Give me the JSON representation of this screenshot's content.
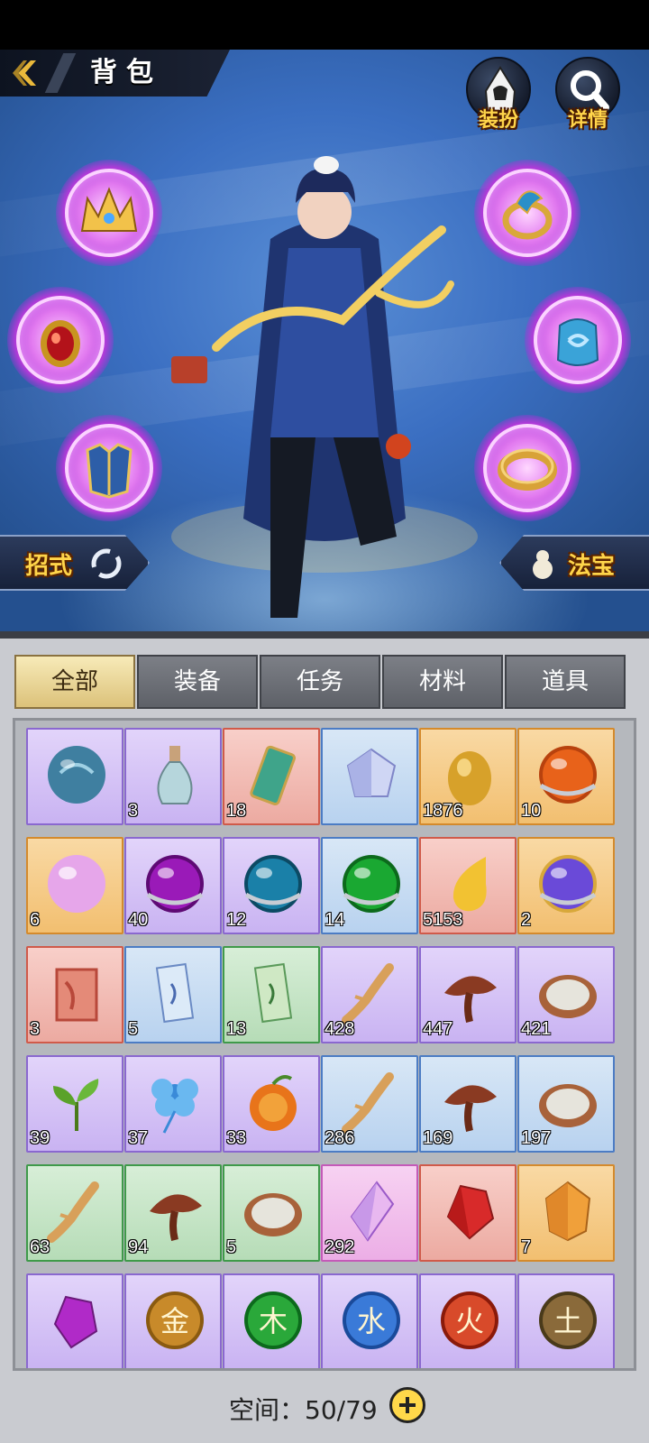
{
  "header": {
    "title": "背包"
  },
  "top_buttons": [
    {
      "label": "装扮",
      "icon": "hooded-figure-icon"
    },
    {
      "label": "详情",
      "icon": "magnifier-icon"
    }
  ],
  "equipment_slots": [
    {
      "icon": "golden-crown-icon",
      "side": "left"
    },
    {
      "icon": "red-gem-amulet-icon",
      "side": "left"
    },
    {
      "icon": "armor-icon",
      "side": "left"
    },
    {
      "icon": "peacock-ring-icon",
      "side": "right"
    },
    {
      "icon": "blue-jade-pendant-icon",
      "side": "right"
    },
    {
      "icon": "gold-bracelet-icon",
      "side": "right"
    }
  ],
  "side_buttons": {
    "moves": {
      "label": "招式",
      "icon": "swirl-icon"
    },
    "treasure": {
      "label": "法宝",
      "icon": "gourd-icon"
    }
  },
  "tabs": [
    {
      "label": "全部",
      "active": true
    },
    {
      "label": "装备",
      "active": false
    },
    {
      "label": "任务",
      "active": false
    },
    {
      "label": "材料",
      "active": false
    },
    {
      "label": "道具",
      "active": false
    }
  ],
  "items": [
    {
      "icon": "blue-spirit-orb-icon",
      "quality": "purple",
      "count": ""
    },
    {
      "icon": "potion-flask-icon",
      "quality": "purple",
      "count": "3"
    },
    {
      "icon": "scroll-token-icon",
      "quality": "red",
      "count": "18"
    },
    {
      "icon": "crystal-gem-icon",
      "quality": "blue",
      "count": ""
    },
    {
      "icon": "gold-nugget-icon",
      "quality": "orange",
      "count": "1876"
    },
    {
      "icon": "orange-orb-icon",
      "quality": "orange",
      "count": "10"
    },
    {
      "icon": "pink-pearl-icon",
      "quality": "orange",
      "count": "6"
    },
    {
      "icon": "purple-orb-icon",
      "quality": "purple",
      "count": "40"
    },
    {
      "icon": "teal-orb-icon",
      "quality": "purple",
      "count": "12"
    },
    {
      "icon": "green-orb-icon",
      "quality": "blue",
      "count": "14"
    },
    {
      "icon": "gold-flame-drop-icon",
      "quality": "red",
      "count": "5153"
    },
    {
      "icon": "cosmic-orb-icon",
      "quality": "orange",
      "count": "2"
    },
    {
      "icon": "red-banner-icon",
      "quality": "red",
      "count": "3"
    },
    {
      "icon": "blue-talisman-icon",
      "quality": "blue",
      "count": "5"
    },
    {
      "icon": "green-talisman-icon",
      "quality": "green",
      "count": "13"
    },
    {
      "icon": "ginseng-root-icon",
      "quality": "purple",
      "count": "428"
    },
    {
      "icon": "lingzhi-mushroom-icon",
      "quality": "purple",
      "count": "447"
    },
    {
      "icon": "rice-bowl-icon",
      "quality": "purple",
      "count": "421"
    },
    {
      "icon": "tea-leaf-icon",
      "quality": "purple",
      "count": "39"
    },
    {
      "icon": "blue-flower-icon",
      "quality": "purple",
      "count": "37"
    },
    {
      "icon": "fire-fruit-icon",
      "quality": "purple",
      "count": "33"
    },
    {
      "icon": "ginseng-root-icon",
      "quality": "blue",
      "count": "286"
    },
    {
      "icon": "lingzhi-mushroom-icon",
      "quality": "blue",
      "count": "169"
    },
    {
      "icon": "rice-bowl-icon",
      "quality": "blue",
      "count": "197"
    },
    {
      "icon": "ginseng-root-icon",
      "quality": "green",
      "count": "63"
    },
    {
      "icon": "lingzhi-mushroom-icon",
      "quality": "green",
      "count": "94"
    },
    {
      "icon": "rice-bowl-icon",
      "quality": "green",
      "count": "5"
    },
    {
      "icon": "prism-crystal-icon",
      "quality": "pink",
      "count": "292"
    },
    {
      "icon": "ruby-icon",
      "quality": "red",
      "count": ""
    },
    {
      "icon": "amber-gem-icon",
      "quality": "orange",
      "count": "7"
    },
    {
      "icon": "purple-crystal-icon",
      "quality": "purple",
      "count": ""
    },
    {
      "icon": "metal-element-orb-icon",
      "quality": "purple",
      "count": "",
      "glyph": "金"
    },
    {
      "icon": "wood-element-orb-icon",
      "quality": "purple",
      "count": "",
      "glyph": "木"
    },
    {
      "icon": "water-element-orb-icon",
      "quality": "purple",
      "count": "",
      "glyph": "水"
    },
    {
      "icon": "fire-element-orb-icon",
      "quality": "purple",
      "count": "",
      "glyph": "火"
    },
    {
      "icon": "earth-element-orb-icon",
      "quality": "purple",
      "count": "",
      "glyph": "土"
    }
  ],
  "footer": {
    "space_label": "空间：",
    "space_value": "50/79"
  }
}
